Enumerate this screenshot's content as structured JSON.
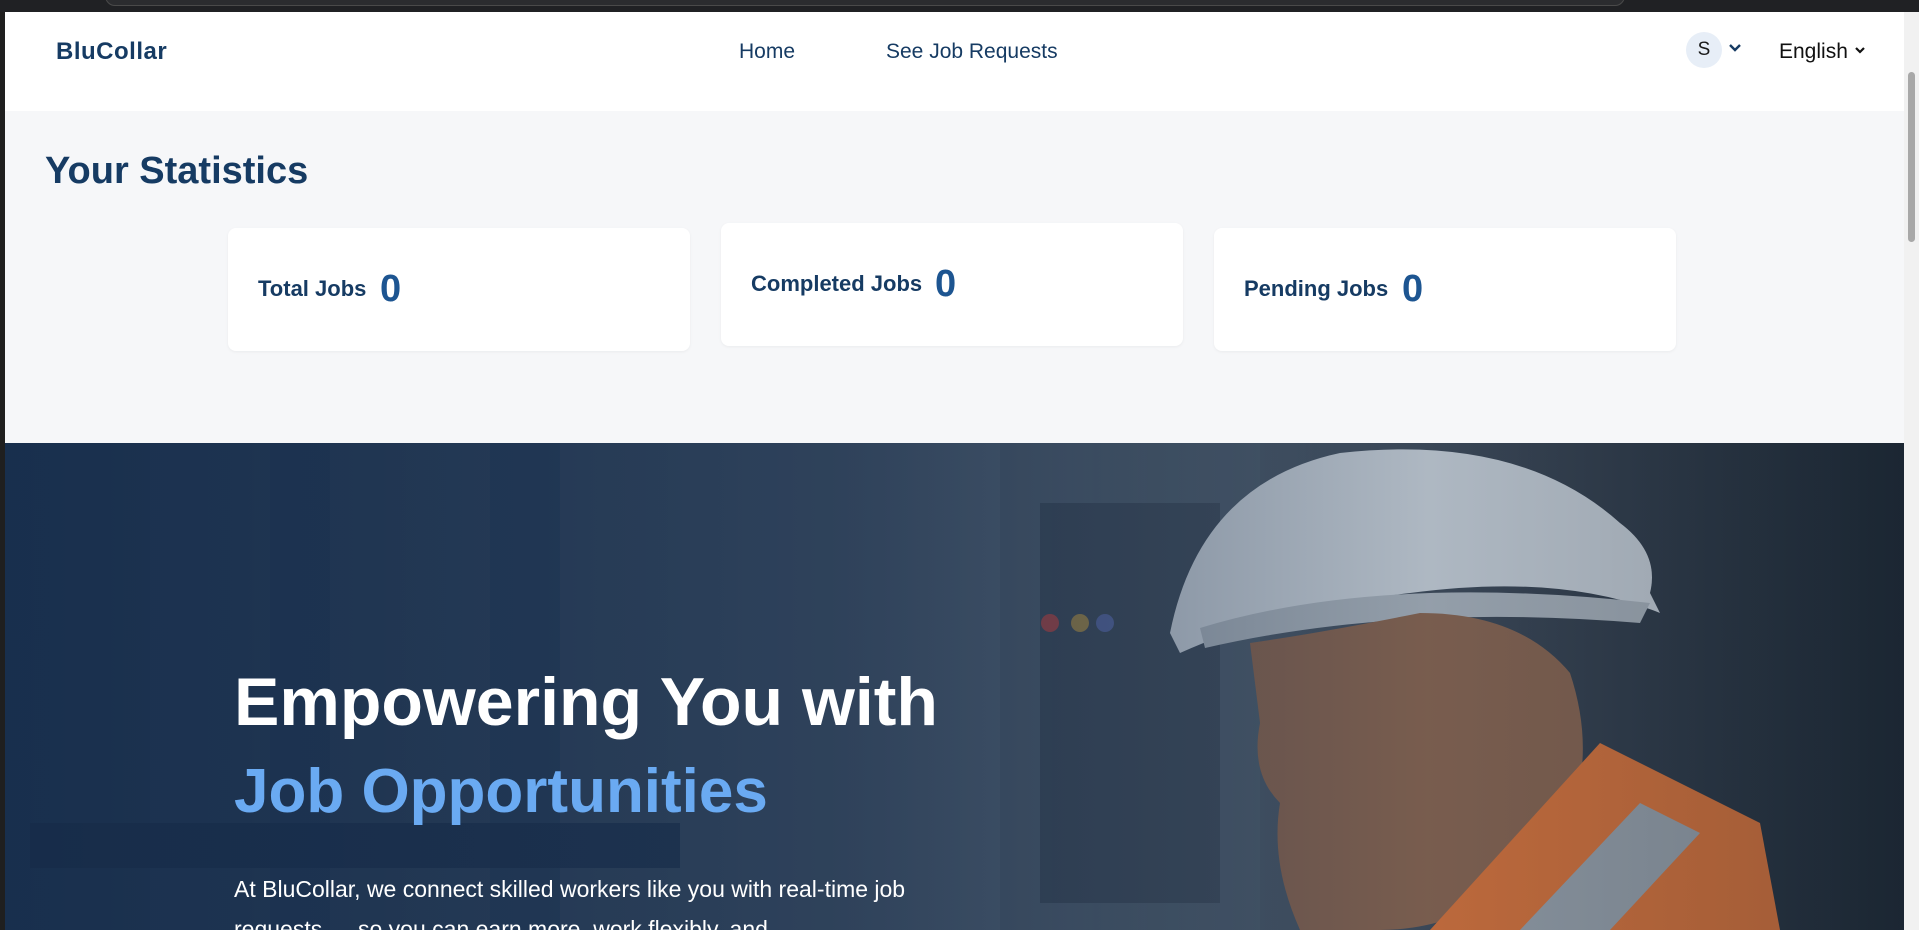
{
  "navbar": {
    "brand": "BluCollar",
    "links": [
      {
        "label": "Home"
      },
      {
        "label": "See Job Requests"
      }
    ],
    "avatar_initial": "S",
    "language": "English"
  },
  "stats": {
    "title": "Your Statistics",
    "cards": [
      {
        "label": "Total Jobs",
        "value": "0"
      },
      {
        "label": "Completed Jobs",
        "value": "0"
      },
      {
        "label": "Pending Jobs",
        "value": "0"
      }
    ]
  },
  "hero": {
    "heading_line1": "Empowering You with",
    "heading_line2": "Job Opportunities",
    "paragraph": "At BluCollar, we connect skilled workers like you with real-time job requests — so you can earn more, work flexibly, and"
  },
  "colors": {
    "brand": "#163b63",
    "accent": "#6aaaf2",
    "stat_value": "#1d5591"
  },
  "icons": {
    "avatar_dropdown": "chevron-down-icon",
    "language_dropdown": "chevron-down-icon"
  }
}
